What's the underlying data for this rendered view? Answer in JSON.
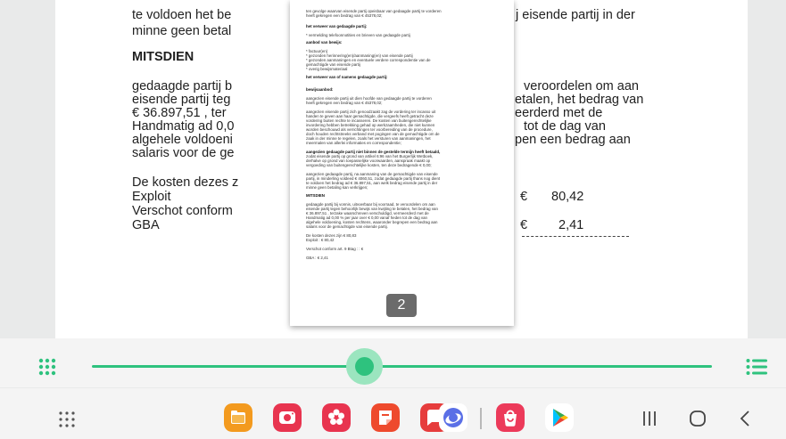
{
  "document": {
    "lines": [
      "te voldoen het be",
      "minne geen betal",
      "MITSDIEN",
      "gedaagde partij b",
      "eisende partij teg",
      "€ 36.897,51 , ter",
      "Handmatig ad 0,0",
      "algehele voldoeni",
      "salaris voor de ge",
      "De kosten dezes z",
      "Exploit",
      "Verschot conform",
      "GBA"
    ],
    "right_fragments": [
      "j eisende partij in der",
      "veroordelen om aan",
      "etalen, het bedrag van",
      "eerderd met de",
      "tot de dag van",
      "pen een bedrag aan"
    ],
    "amounts": [
      {
        "currency": "€",
        "value": "80,42"
      },
      {
        "currency": "€",
        "value": "2,41"
      }
    ]
  },
  "preview": {
    "lines": [
      {
        "text": "ten gevolge waarvan eisende partij opeisbaar van gedaagde partij te vorderen",
        "bold": false
      },
      {
        "text": "heeft gekregen een bedrag van € 45378,02;",
        "bold": false
      },
      {
        "text": "het verweer van gedaagde partij:",
        "bold": true
      },
      {
        "text": "* vermelding telefoonnotities en brieven van gedaagde partij",
        "bold": false
      },
      {
        "text": "aanbod van bewijs:",
        "bold": true
      },
      {
        "text": "* factuur(en)",
        "bold": false
      },
      {
        "text": "* gezonden herinnering(en)/aanmaning(en) van eisende partij",
        "bold": false
      },
      {
        "text": "* gezonden aanmaningen en eventuele verdere correspondentie van de",
        "bold": false
      },
      {
        "text": "  gemachtigde van eisende partij",
        "bold": false
      },
      {
        "text": "* overig bewijsmateriaal",
        "bold": false
      },
      {
        "text": "het verweer van of namens gedaagde partij:",
        "bold": true
      },
      {
        "text": "bewijsaanbod:",
        "bold": true
      },
      {
        "text": "aangezien eisende partij uit dien hoofde van gedaagde partij te vorderen",
        "bold": false
      },
      {
        "text": "heeft gekregen een bedrag van € 45378,02;",
        "bold": false
      },
      {
        "text": "aangezien eisende partij zich genoodzaakt zag de vordering ter incasso uit",
        "bold": false
      },
      {
        "text": "handen te geven aan haar gemachtigde, die vergeefs heeft getracht deze",
        "bold": false
      },
      {
        "text": "vordering buiten rechte te incasseren. De kosten van buitengerechtelijke",
        "bold": false
      },
      {
        "text": "invordering hebben betrekking gehad op werkzaamheden, die niet kunnen",
        "bold": false
      },
      {
        "text": "worden beschouwd als verrichtingen ter voorbereiding van de procedure,",
        "bold": false
      },
      {
        "text": "doch houden rechtstreeks verband met pogingen van de gemachtigde om de",
        "bold": false
      },
      {
        "text": "zaak in der minne te regelen, zoals het versturen van aanmaningen, het",
        "bold": false
      },
      {
        "text": "meermalen van allerlei informaties en correspondentie;",
        "bold": false
      },
      {
        "text": "aangezien gedaagde partij niet binnen de gestelde termijn heeft betaald,",
        "bold": true
      },
      {
        "text": "zodat eisende partij op grond van artikel 6:96 van het Burgerlijk Wetboek,",
        "bold": false
      },
      {
        "text": "derhalve op grond van toepasselijke voorwaarden, aanspraak maakt op",
        "bold": false
      },
      {
        "text": "vergoeding van buitengerechtelijke kosten, ten deze bedragende € 0,00;",
        "bold": false
      },
      {
        "text": "aangezien gedaagde partij, na aanmaning van de gemachtigde van eisende",
        "bold": false
      },
      {
        "text": "partij, in minderling voldeed € 4060,51, zodat gedaagde partij thans nog dient",
        "bold": false
      },
      {
        "text": "te voldoen het bedrag ad € 36.897,51, aan welk bedrag eisende partij in der",
        "bold": false
      },
      {
        "text": "minne geen betaling kan verkrijgen;",
        "bold": false
      },
      {
        "text": "MITSDIEN",
        "bold": true
      },
      {
        "text": "gedaagde partij bij vonnis, uitvoerbaar bij voorraad, te veroordelen om aan",
        "bold": false
      },
      {
        "text": "eisende partij tegen behoorlijk bewijs van kwijting te betalen, het bedrag van",
        "bold": false
      },
      {
        "text": "€ 36.897,51 , terzake waarschreven verschuldigd, vermeerderd met de",
        "bold": false
      },
      {
        "text": "Handmatig ad 0,00 % per jaar over € 0,00 vanaf heden tot de dag van",
        "bold": false
      },
      {
        "text": "algehele voldoening, kosten rechtens, waaronder begrepen een bedrag aan",
        "bold": false
      },
      {
        "text": "salaris voor de gemachtigde van eisende partij.",
        "bold": false
      },
      {
        "text": "De kosten dezes zijn € 80,83",
        "bold": false
      },
      {
        "text": "Exploit                                                     : €      80,42",
        "bold": false
      },
      {
        "text": "Verschot conform art. 9 Btag :                       : €",
        "bold": false
      },
      {
        "text": "GBA                                                        : €       2,41",
        "bold": false
      }
    ],
    "page_number": "2"
  },
  "scrubber": {
    "progress": 0.44
  },
  "colors": {
    "accent": "#2ec27e",
    "accent_light": "#9be5bf"
  },
  "taskbar": {
    "apps": [
      {
        "name": "my-files-icon",
        "color": "#f39a1e"
      },
      {
        "name": "camera-icon",
        "color": "#e8344f"
      },
      {
        "name": "gallery-icon",
        "color": "#e8344f"
      },
      {
        "name": "notes-icon",
        "color": "#ee4a2d"
      },
      {
        "name": "messages-icon",
        "color": "#e63c3c"
      },
      {
        "name": "internet-icon",
        "color": "#5a6fe6"
      },
      {
        "name": "galaxy-store-icon",
        "color": "#ec3a5a"
      },
      {
        "name": "play-store-icon",
        "color": "#ffffff"
      }
    ]
  }
}
